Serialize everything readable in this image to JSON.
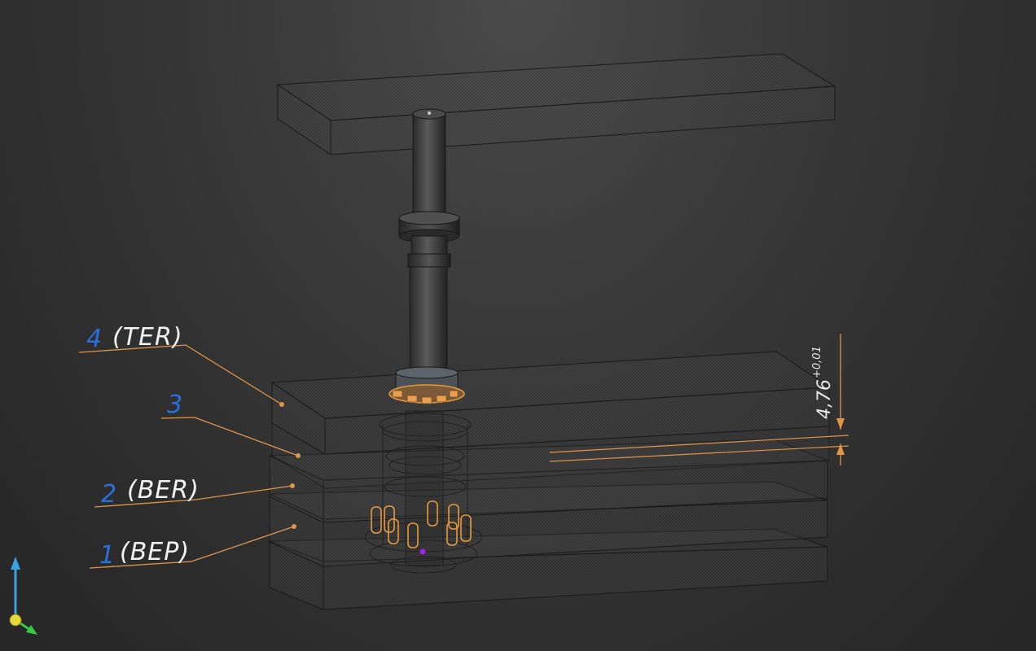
{
  "callouts": [
    {
      "number": "4",
      "tag": "(TER)"
    },
    {
      "number": "3",
      "tag": ""
    },
    {
      "number": "2",
      "tag": "(BER)"
    },
    {
      "number": "1",
      "tag": "(BEP)"
    }
  ],
  "dimension": {
    "value": "4,76",
    "tolerance": "+0,01"
  },
  "colors": {
    "leader": "#e0954a",
    "callout_number": "#2a6fe0",
    "callout_text": "#f2f2f2",
    "plate_edge": "#1a1a1a",
    "shaft": "#3c3c3c",
    "pins": "#e89a3c",
    "axis_z": "#3aa0e8",
    "axis_origin": "#e8d83a",
    "axis_x": "#3ac84a"
  },
  "triad": {
    "icon": "coordinate-triad-icon"
  }
}
